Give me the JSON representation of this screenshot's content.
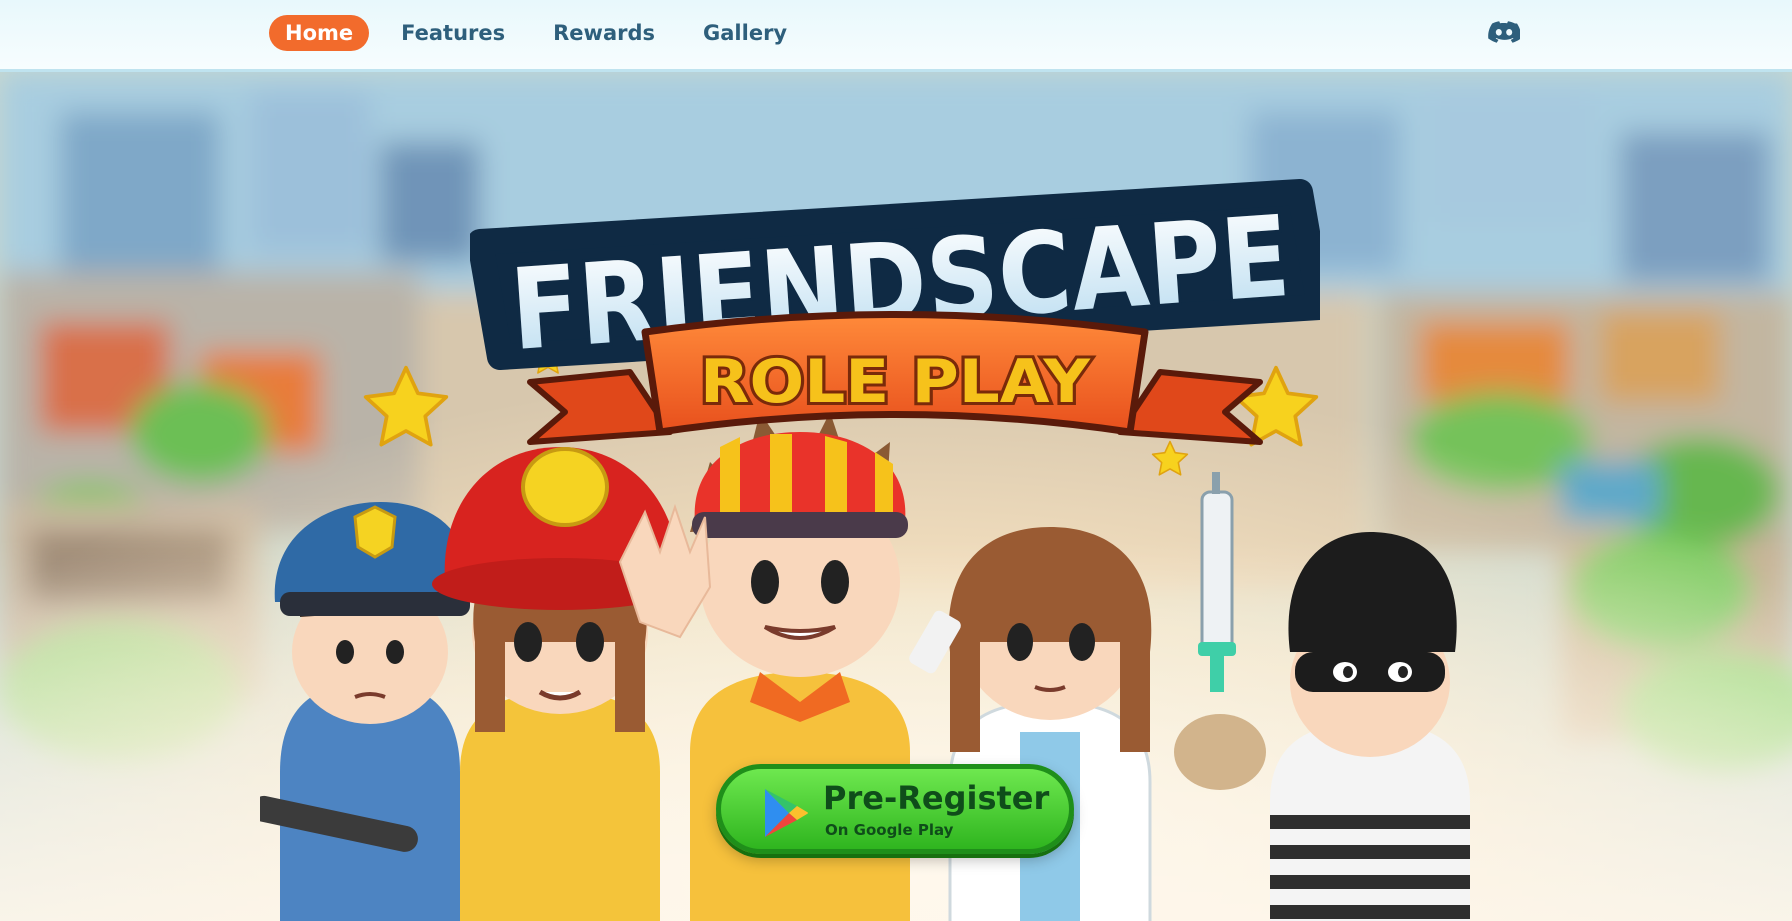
{
  "nav": {
    "items": [
      {
        "label": "Home",
        "active": true
      },
      {
        "label": "Features",
        "active": false
      },
      {
        "label": "Rewards",
        "active": false
      },
      {
        "label": "Gallery",
        "active": false
      }
    ],
    "social_icon": "discord-icon"
  },
  "hero": {
    "logo_title": "FRIENDSCAPE",
    "logo_subtitle": "ROLE PLAY",
    "cta": {
      "title": "Pre-Register",
      "subtitle": "On Google Play",
      "icon": "google-play-icon"
    }
  },
  "colors": {
    "accent": "#f26b2c",
    "nav_text": "#2e5f7c",
    "cta_green": "#3fcf2a",
    "banner_orange": "#f06a22",
    "banner_yellow": "#f6c21b"
  }
}
